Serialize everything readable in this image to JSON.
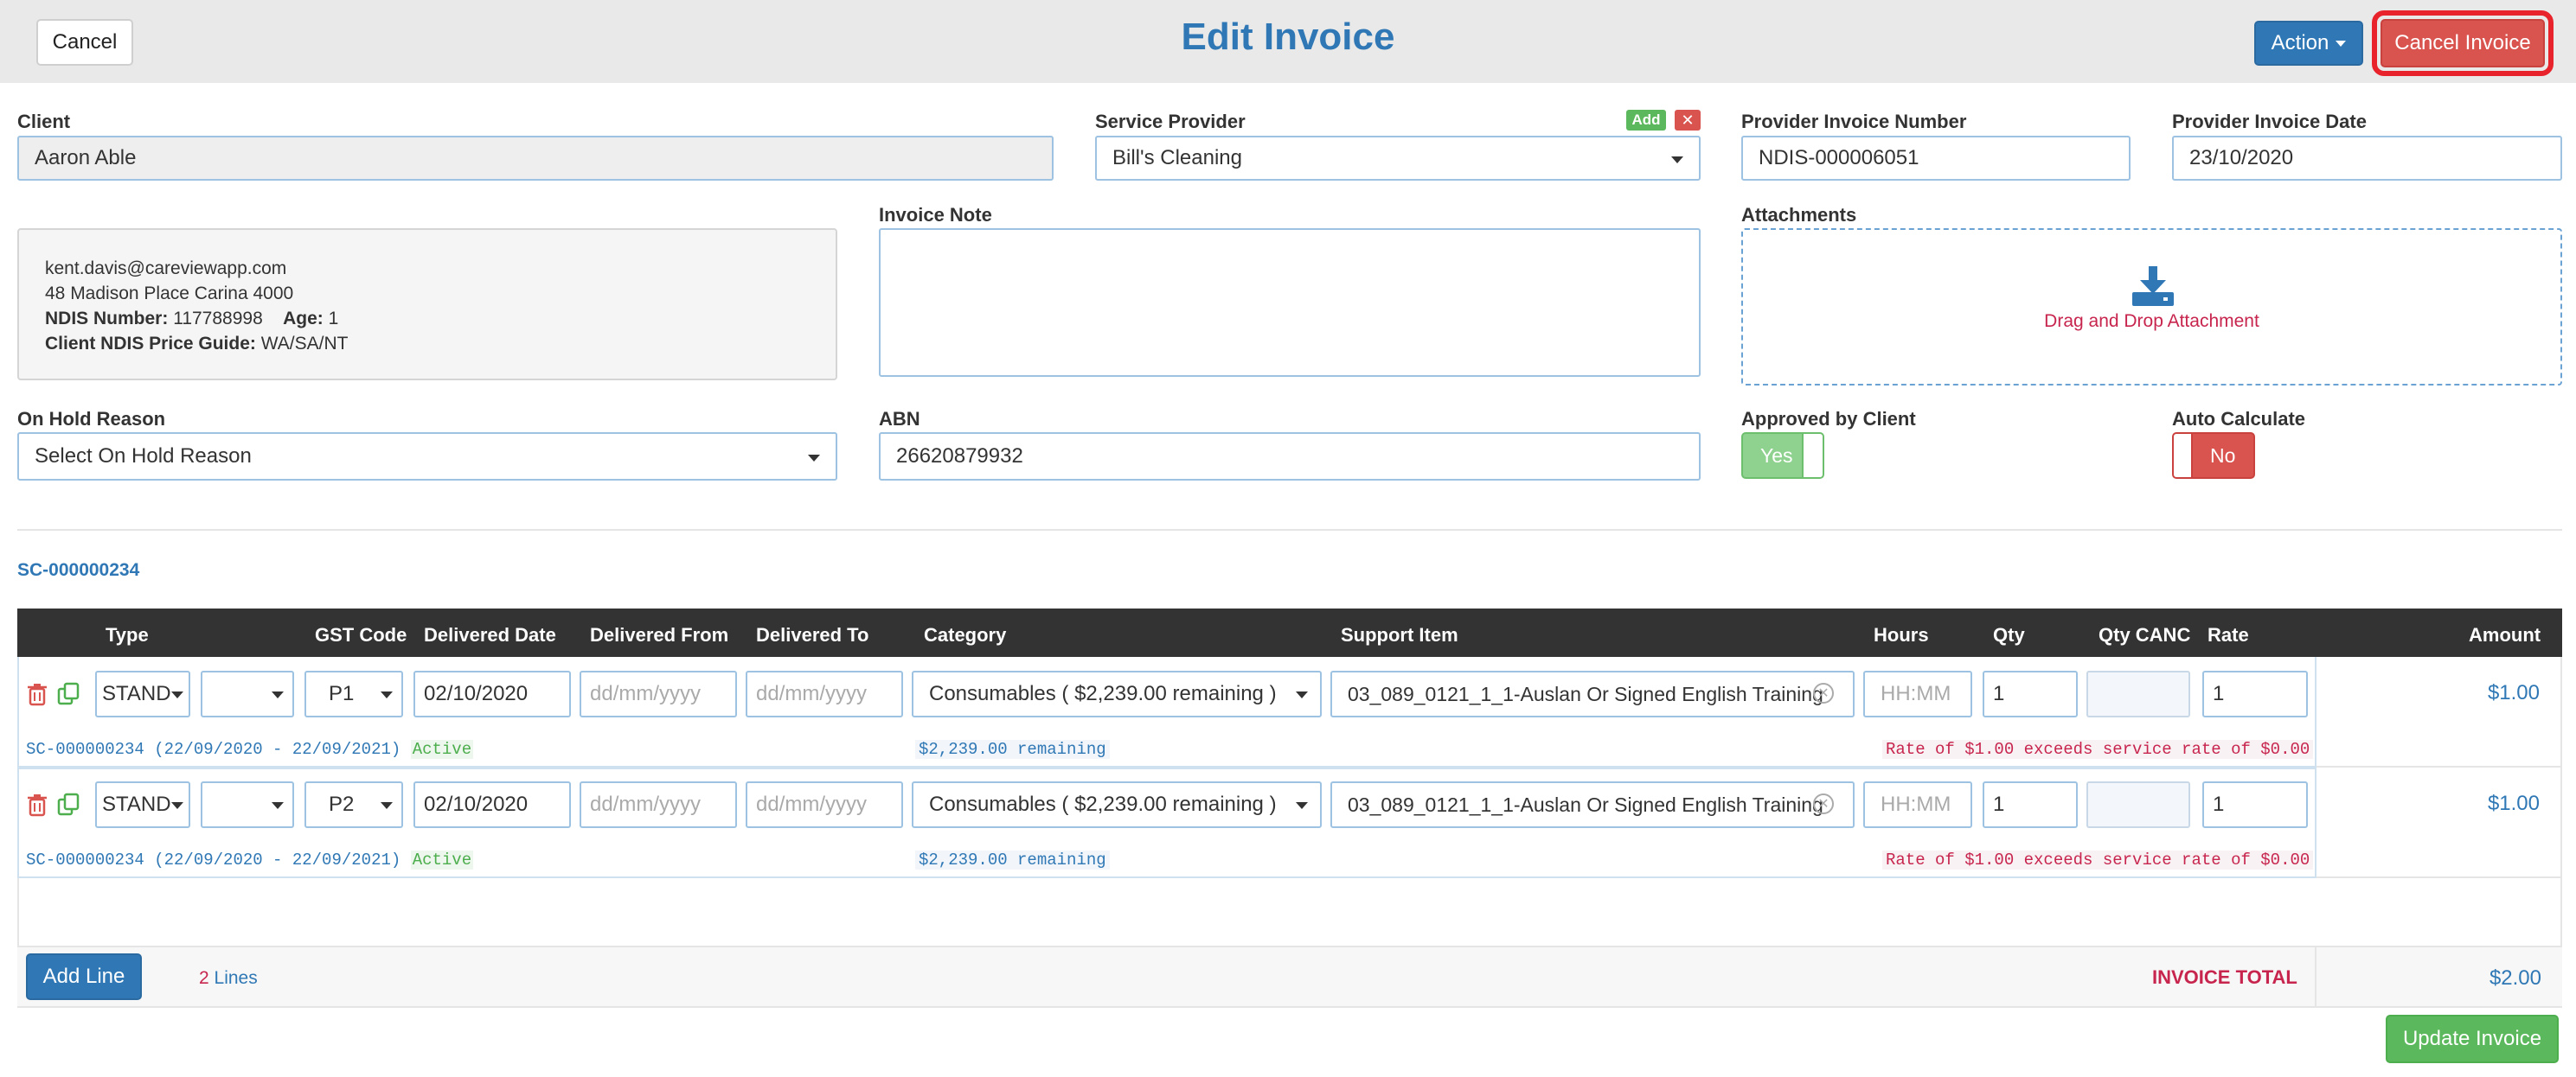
{
  "header": {
    "title": "Edit Invoice",
    "cancel_label": "Cancel",
    "action_label": "Action",
    "cancel_invoice_label": "Cancel Invoice"
  },
  "form": {
    "client_label": "Client",
    "client_value": "Aaron Able",
    "service_provider_label": "Service Provider",
    "service_provider_value": "Bill's Cleaning",
    "add_badge": "Add",
    "remove_badge": "✕",
    "provider_invoice_number_label": "Provider Invoice Number",
    "provider_invoice_number_value": "NDIS-000006051",
    "provider_invoice_date_label": "Provider Invoice Date",
    "provider_invoice_date_value": "23/10/2020",
    "invoice_note_label": "Invoice Note",
    "invoice_note_value": "",
    "attachments_label": "Attachments",
    "attachments_hint": "Drag and Drop Attachment",
    "on_hold_label": "On Hold Reason",
    "on_hold_value": "Select On Hold Reason",
    "abn_label": "ABN",
    "abn_value": "26620879932",
    "approved_label": "Approved by Client",
    "approved_value": "Yes",
    "auto_calc_label": "Auto Calculate",
    "auto_calc_value": "No"
  },
  "client_info": {
    "email": "kent.davis@careviewapp.com",
    "address": "48 Madison Place Carina 4000",
    "ndis_label": "NDIS Number:",
    "ndis_value": "117788998",
    "age_label": "Age:",
    "age_value": "1",
    "price_guide_label": "Client NDIS Price Guide:",
    "price_guide_value": "WA/SA/NT"
  },
  "service_contract": "SC-000000234",
  "table": {
    "headers": {
      "type": "Type",
      "gst": "GST Code",
      "delivered_date": "Delivered Date",
      "delivered_from": "Delivered From",
      "delivered_to": "Delivered To",
      "category": "Category",
      "support_item": "Support Item",
      "hours": "Hours",
      "qty": "Qty",
      "qty_canc": "Qty CANC",
      "rate": "Rate",
      "amount": "Amount"
    },
    "rows": [
      {
        "type": "STAND",
        "gst": "P1",
        "delivered_date": "02/10/2020",
        "from_placeholder": "dd/mm/yyyy",
        "to_placeholder": "dd/mm/yyyy",
        "category": "Consumables ( $2,239.00 remaining )",
        "support_item": "03_089_0121_1_1-Auslan Or Signed English Training",
        "hours_placeholder": "HH:MM",
        "qty": "1",
        "rate": "1",
        "amount": "$1.00",
        "sc_info": "SC-000000234 (22/09/2020 - 22/09/2021)",
        "status": "Active",
        "remaining_amount": "$2,239.00",
        "remaining_word": "remaining",
        "warning": "Rate of $1.00 exceeds service rate of $0.00"
      },
      {
        "type": "STAND",
        "gst": "P2",
        "delivered_date": "02/10/2020",
        "from_placeholder": "dd/mm/yyyy",
        "to_placeholder": "dd/mm/yyyy",
        "category": "Consumables ( $2,239.00 remaining )",
        "support_item": "03_089_0121_1_1-Auslan Or Signed English Training",
        "hours_placeholder": "HH:MM",
        "qty": "1",
        "rate": "1",
        "amount": "$1.00",
        "sc_info": "SC-000000234 (22/09/2020 - 22/09/2021)",
        "status": "Active",
        "remaining_amount": "$2,239.00",
        "remaining_word": "remaining",
        "warning": "Rate of $1.00 exceeds service rate of $0.00"
      }
    ]
  },
  "footer": {
    "add_line_label": "Add Line",
    "lines_count": "2",
    "lines_word": "Lines",
    "total_label": "INVOICE TOTAL",
    "total_value": "$2.00",
    "update_label": "Update Invoice"
  },
  "colors": {
    "primary": "#2f78b5",
    "danger": "#d9534f",
    "success": "#5cb85c",
    "header_bg": "#333333",
    "warning_text": "#c7254e"
  }
}
